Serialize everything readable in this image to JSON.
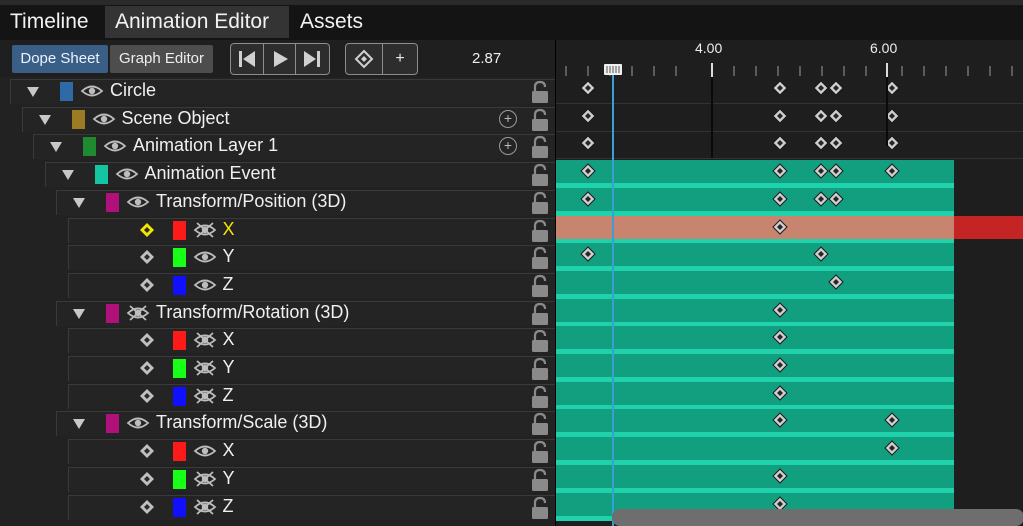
{
  "tabs": [
    {
      "label": "Timeline",
      "active": false
    },
    {
      "label": "Animation Editor",
      "active": true
    },
    {
      "label": "Assets",
      "active": false
    }
  ],
  "toolbar": {
    "dope_sheet_label": "Dope Sheet",
    "graph_editor_label": "Graph Editor",
    "add_key_label": "+",
    "time_value": "2.87"
  },
  "timeline": {
    "ruler_labels": [
      "4.00",
      "6.00"
    ],
    "current_time": 2.87
  },
  "tree": {
    "rows": [
      {
        "name": "Circle",
        "color": "#2e6aa8",
        "eye": "visible",
        "expander": true,
        "plus": false
      },
      {
        "name": "Scene Object",
        "color": "#9b7c24",
        "eye": "visible",
        "expander": true,
        "plus": true
      },
      {
        "name": "Animation Layer 1",
        "color": "#1f8a2f",
        "eye": "visible",
        "expander": true,
        "plus": true
      },
      {
        "name": "Animation Event",
        "color": "#15c4a0",
        "eye": "visible",
        "expander": true,
        "plus": false
      },
      {
        "name": "Transform/Position (3D)",
        "color": "#b0107a",
        "eye": "visible",
        "expander": true,
        "plus": false
      },
      {
        "name": "X",
        "color": "#ff1a1a",
        "eye": "hidden",
        "expander": false,
        "plus": false,
        "selected": true
      },
      {
        "name": "Y",
        "color": "#18ff18",
        "eye": "visible",
        "expander": false,
        "plus": false
      },
      {
        "name": "Z",
        "color": "#1010ff",
        "eye": "visible",
        "expander": false,
        "plus": false
      },
      {
        "name": "Transform/Rotation (3D)",
        "color": "#b0107a",
        "eye": "hidden",
        "expander": true,
        "plus": false
      },
      {
        "name": "X",
        "color": "#ff1a1a",
        "eye": "hidden",
        "expander": false,
        "plus": false
      },
      {
        "name": "Y",
        "color": "#18ff18",
        "eye": "hidden",
        "expander": false,
        "plus": false
      },
      {
        "name": "Z",
        "color": "#1010ff",
        "eye": "hidden",
        "expander": false,
        "plus": false
      },
      {
        "name": "Transform/Scale (3D)",
        "color": "#b0107a",
        "eye": "visible",
        "expander": true,
        "plus": false
      },
      {
        "name": "X",
        "color": "#ff1a1a",
        "eye": "visible",
        "expander": false,
        "plus": false
      },
      {
        "name": "Y",
        "color": "#18ff18",
        "eye": "hidden",
        "expander": false,
        "plus": false
      },
      {
        "name": "Z",
        "color": "#1010ff",
        "eye": "hidden",
        "expander": false,
        "plus": false
      }
    ]
  },
  "colors": {
    "accent": "#3a5f86",
    "track_fill": "#119f80",
    "track_band": "#1fd2ab",
    "selected_track": "#c9846f",
    "selected_track_end": "#c42424",
    "playhead": "#3a9fd4",
    "selected_label": "#f5e600"
  }
}
